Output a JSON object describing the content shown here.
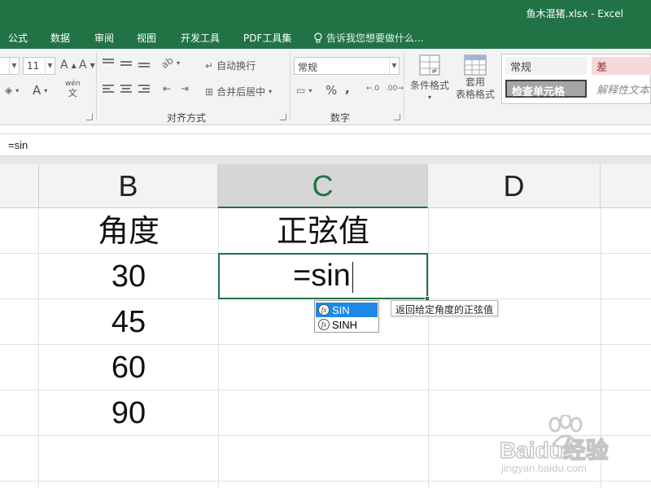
{
  "window": {
    "title": "鱼木混猪.xlsx - Excel"
  },
  "tabs": [
    "公式",
    "数据",
    "审阅",
    "视图",
    "开发工具",
    "PDF工具集"
  ],
  "tell_me": {
    "placeholder": "告诉我您想要做什么..."
  },
  "ribbon": {
    "font_size": "11",
    "font_grow": "A",
    "font_shrink": "A",
    "font_color_label": "A",
    "phonetic": "wén",
    "phonetic_sub": "文",
    "wrap_text": "自动换行",
    "merge_center": "合并后居中",
    "alignment_group": "对齐方式",
    "number_format": "常规",
    "percent": "%",
    "comma": ",",
    "number_group": "数字",
    "cond_format": "条件格式",
    "table_format_line1": "套用",
    "table_format_line2": "表格格式",
    "style_normal": "常规",
    "style_bad": "差",
    "style_check": "检查单元格",
    "style_explain": "解释性文本"
  },
  "formula_bar": {
    "value": "=sin"
  },
  "columns": [
    {
      "label": "B",
      "active": false
    },
    {
      "label": "C",
      "active": true
    },
    {
      "label": "D",
      "active": false
    }
  ],
  "sheet": {
    "header_row": {
      "b": "角度",
      "c": "正弦值"
    },
    "angles": [
      "30",
      "45",
      "60",
      "90"
    ],
    "editing_text": "=sin"
  },
  "autocomplete": {
    "items": [
      {
        "name": "SIN",
        "selected": true
      },
      {
        "name": "SINH",
        "selected": false
      }
    ],
    "tooltip": "返回给定角度的正弦值"
  },
  "watermark": {
    "brand": "Baidu经验",
    "url": "jingyan.baidu.com"
  },
  "colors": {
    "excel_green": "#217346",
    "selection_blue": "#1e88e5"
  }
}
